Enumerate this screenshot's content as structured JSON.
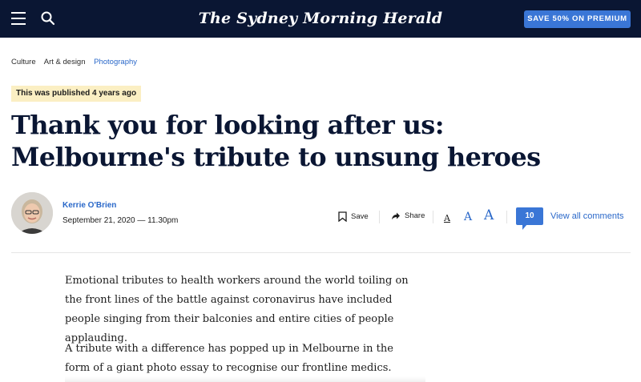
{
  "header": {
    "masthead": "The Sydney Morning Herald",
    "premium_button": "SAVE 50% ON PREMIUM",
    "colors": {
      "background": "#0a1633",
      "accent": "#3a76d6"
    }
  },
  "breadcrumb": {
    "items": [
      {
        "label": "Culture"
      },
      {
        "label": "Art & design"
      },
      {
        "label": "Photography"
      }
    ]
  },
  "article": {
    "published_badge": "This was published 4 years ago",
    "headline": "Thank you for looking after us: Melbourne's tribute to unsung heroes",
    "author": "Kerrie O'Brien",
    "date": "September 21, 2020 — 11.30pm",
    "paragraphs": [
      "Emotional tributes to health workers around the world toiling on the front lines of the battle against coronavirus have included people singing from their balconies and entire cities of people applauding.",
      "A tribute with a difference has popped up in Melbourne in the form of a giant photo essay to recognise our frontline medics."
    ]
  },
  "toolbar": {
    "save_label": "Save",
    "share_label": "Share",
    "font_size_letter": "A",
    "comment_count": "10",
    "view_comments_label": "View all comments"
  },
  "icons": [
    "menu-icon",
    "search-icon",
    "bookmark-icon",
    "share-arrow-icon",
    "comment-bubble-icon"
  ]
}
